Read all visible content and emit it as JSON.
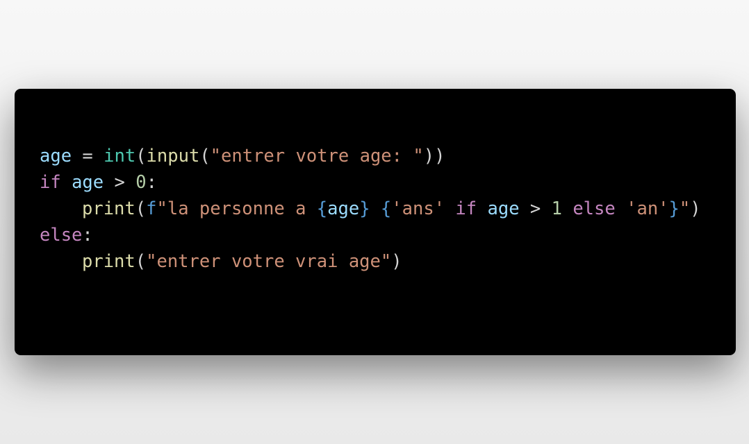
{
  "colors": {
    "background": "#f0f0f0",
    "editor_background": "#000000",
    "variable": "#9cdcfe",
    "builtin_type": "#4ec9b0",
    "function": "#dcdcaa",
    "string": "#ce9178",
    "keyword": "#c586c0",
    "number": "#b5cea8",
    "fstring_prefix": "#569cd6",
    "default_text": "#d4d4d4"
  },
  "code": {
    "lines": [
      {
        "indent": false,
        "tokens": [
          {
            "text": "age",
            "type": "var"
          },
          {
            "text": " = ",
            "type": "op"
          },
          {
            "text": "int",
            "type": "builtin-type"
          },
          {
            "text": "(",
            "type": "punct"
          },
          {
            "text": "input",
            "type": "func"
          },
          {
            "text": "(",
            "type": "punct"
          },
          {
            "text": "\"entrer votre age: \"",
            "type": "string"
          },
          {
            "text": "))",
            "type": "punct"
          }
        ]
      },
      {
        "indent": false,
        "tokens": [
          {
            "text": "if",
            "type": "keyword"
          },
          {
            "text": " ",
            "type": "op"
          },
          {
            "text": "age",
            "type": "var"
          },
          {
            "text": " > ",
            "type": "op"
          },
          {
            "text": "0",
            "type": "number"
          },
          {
            "text": ":",
            "type": "punct"
          }
        ]
      },
      {
        "indent": true,
        "tokens": [
          {
            "text": "print",
            "type": "func"
          },
          {
            "text": "(",
            "type": "punct"
          },
          {
            "text": "f",
            "type": "fprefix"
          },
          {
            "text": "\"la personne a ",
            "type": "string"
          },
          {
            "text": "{",
            "type": "brace"
          },
          {
            "text": "age",
            "type": "var"
          },
          {
            "text": "}",
            "type": "brace"
          },
          {
            "text": " ",
            "type": "string"
          },
          {
            "text": "{",
            "type": "brace"
          },
          {
            "text": "'ans'",
            "type": "string"
          },
          {
            "text": " ",
            "type": "op"
          },
          {
            "text": "if",
            "type": "keyword"
          },
          {
            "text": " ",
            "type": "op"
          },
          {
            "text": "age",
            "type": "var"
          },
          {
            "text": " > ",
            "type": "op"
          },
          {
            "text": "1",
            "type": "number"
          },
          {
            "text": " ",
            "type": "op"
          },
          {
            "text": "else",
            "type": "keyword"
          },
          {
            "text": " ",
            "type": "op"
          },
          {
            "text": "'an'",
            "type": "string"
          },
          {
            "text": "}",
            "type": "brace"
          },
          {
            "text": "\"",
            "type": "string"
          },
          {
            "text": ")",
            "type": "punct"
          }
        ]
      },
      {
        "indent": false,
        "tokens": [
          {
            "text": "else",
            "type": "keyword"
          },
          {
            "text": ":",
            "type": "punct"
          }
        ]
      },
      {
        "indent": true,
        "tokens": [
          {
            "text": "print",
            "type": "func"
          },
          {
            "text": "(",
            "type": "punct"
          },
          {
            "text": "\"entrer votre vrai age\"",
            "type": "string"
          },
          {
            "text": ")",
            "type": "punct"
          }
        ]
      }
    ]
  }
}
